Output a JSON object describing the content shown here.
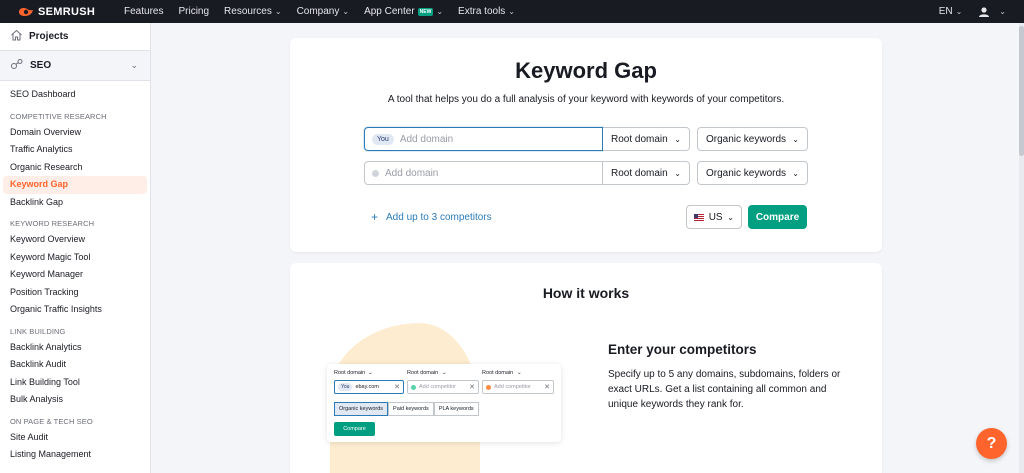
{
  "brand": {
    "name": "SEMRUSH",
    "accent": "#ff642d"
  },
  "topnav": {
    "items": [
      {
        "label": "Features",
        "dropdown": false
      },
      {
        "label": "Pricing",
        "dropdown": false
      },
      {
        "label": "Resources",
        "dropdown": true
      },
      {
        "label": "Company",
        "dropdown": true
      },
      {
        "label": "App Center",
        "dropdown": true,
        "badge": "NEW"
      },
      {
        "label": "Extra tools",
        "dropdown": true
      }
    ],
    "language": "EN",
    "user_icon": "user-icon"
  },
  "sidebar": {
    "projects_label": "Projects",
    "seo_label": "SEO",
    "dashboard": "SEO Dashboard",
    "sections": [
      {
        "title": "COMPETITIVE RESEARCH",
        "items": [
          "Domain Overview",
          "Traffic Analytics",
          "Organic Research",
          "Keyword Gap",
          "Backlink Gap"
        ]
      },
      {
        "title": "KEYWORD RESEARCH",
        "items": [
          "Keyword Overview",
          "Keyword Magic Tool",
          "Keyword Manager",
          "Position Tracking",
          "Organic Traffic Insights"
        ]
      },
      {
        "title": "LINK BUILDING",
        "items": [
          "Backlink Analytics",
          "Backlink Audit",
          "Link Building Tool",
          "Bulk Analysis"
        ]
      },
      {
        "title": "ON PAGE & TECH SEO",
        "items": [
          "Site Audit",
          "Listing Management"
        ]
      }
    ],
    "active_item": "Keyword Gap"
  },
  "keyword_gap": {
    "title": "Keyword Gap",
    "subtitle": "A tool that helps you do a full analysis of your keyword with keywords of your competitors.",
    "rows": [
      {
        "pill": "You",
        "placeholder": "Add domain",
        "root": "Root domain",
        "keywords": "Organic keywords"
      },
      {
        "pill": "",
        "placeholder": "Add domain",
        "root": "Root domain",
        "keywords": "Organic keywords"
      }
    ],
    "add_competitors": "Add up to 3 competitors",
    "country": "US",
    "compare_label": "Compare"
  },
  "how_it_works": {
    "title": "How it works",
    "step_title": "Enter your competitors",
    "step_text": "Specify up to 5 any domains, subdomains, folders or exact URLs. Get a list containing all common and unique keywords they rank for.",
    "illustration": {
      "labels": [
        "Root domain",
        "Root domain",
        "Root domain"
      ],
      "you_pill": "You",
      "you_domain": "ebay.com",
      "placeholders": [
        "Add competitor",
        "Add competitor"
      ],
      "tabs": [
        "Organic keywords",
        "Paid keywords",
        "PLA keywords"
      ],
      "button": "Compare"
    }
  },
  "help_label": "?"
}
